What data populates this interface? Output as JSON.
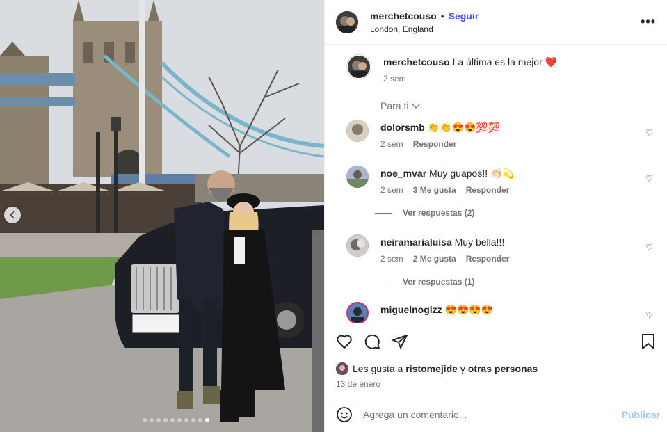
{
  "post": {
    "username": "merchetcouso",
    "separator": "•",
    "follow_label": "Seguir",
    "location": "London, England",
    "more_label": "•••"
  },
  "caption": {
    "username": "merchetcouso",
    "text": "La última es la mejor ❤️",
    "age": "2 sem"
  },
  "sort_label": "Para ti",
  "comments": [
    {
      "username": "dolorsmb",
      "text": "👏👏😍😍💯💯",
      "age": "2 sem",
      "likes": "",
      "reply_label": "Responder",
      "avatar_color": "#8a7a68"
    },
    {
      "username": "noe_mvar",
      "text": "Muy guapos!! 👏🏻💫",
      "age": "2 sem",
      "likes": "3 Me gusta",
      "reply_label": "Responder",
      "avatar_color": "#6b7c96",
      "replies": "Ver respuestas (2)"
    },
    {
      "username": "neiramarialuisa",
      "text": "Muy bella!!!",
      "age": "2 sem",
      "likes": "2 Me gusta",
      "reply_label": "Responder",
      "avatar_color": "#9a9590",
      "replies": "Ver respuestas (1)"
    },
    {
      "username": "miguelnoglzz",
      "text": "😍😍😍😍",
      "age": "",
      "likes": "",
      "reply_label": "",
      "avatar_color": "#3a4c6b"
    }
  ],
  "likes": {
    "prefix": "Les gusta a",
    "user": "ristomejide",
    "joiner": "y",
    "others": "otras personas"
  },
  "date": "13 de enero",
  "composer": {
    "placeholder": "Agrega un comentario...",
    "publish_label": "Publicar"
  },
  "carousel": {
    "count": 10,
    "active_index": 9
  },
  "colors": {
    "follow": "#4150f7",
    "publish": "#9fc7f5",
    "heart": "#ed4956"
  }
}
